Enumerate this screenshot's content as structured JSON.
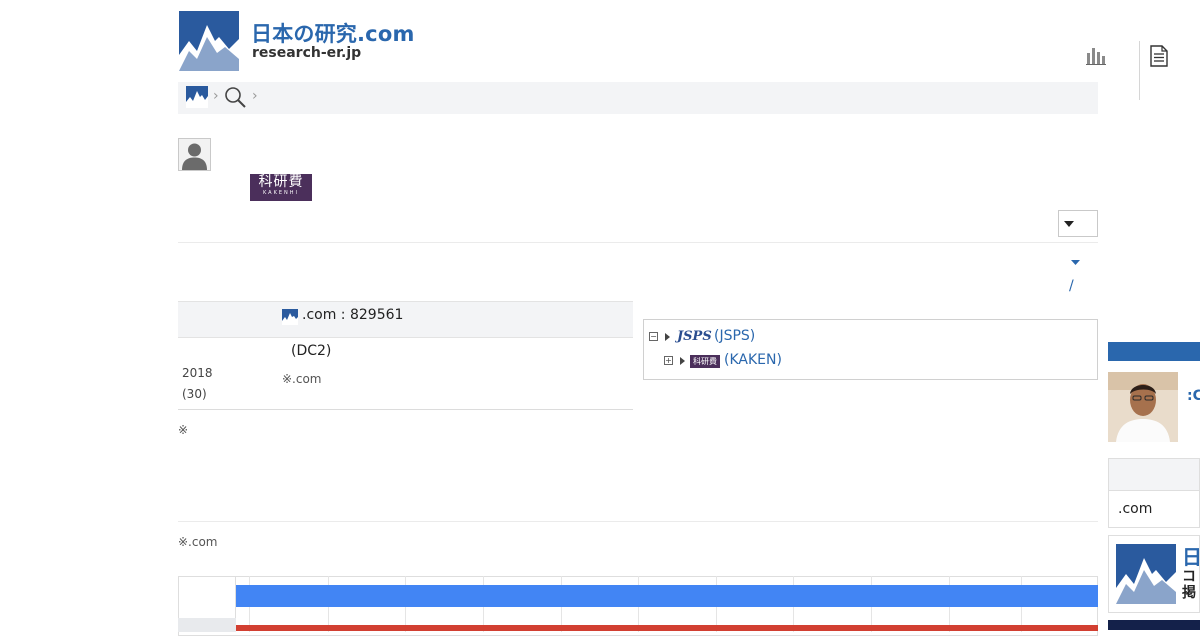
{
  "header": {
    "site_title": "日本の研究.com",
    "site_domain": "research-er.jp",
    "ranking_icon": "bar-chart-icon",
    "document_icon": "document-icon"
  },
  "breadcrumb": {
    "home_icon": "mountain-logo-icon",
    "search_icon": "search-icon",
    "separator": "›"
  },
  "kakenhi_logo": {
    "kanji": "科研費",
    "romaji": "KAKENHI"
  },
  "sort": {
    "slash": "/"
  },
  "info": {
    "id_text": ".com : 829561",
    "grant_type": "(DC2)",
    "year": "2018",
    "count": "(30)",
    "source_note": "※.com"
  },
  "note_mark": "※",
  "bottom_note": "※.com",
  "tree": {
    "jsps_mark": "JSPS",
    "jsps_label": "(JSPS)",
    "jsps_toggle": "−",
    "kaken_mark": "科研費",
    "kaken_label": "(KAKEN)",
    "kaken_toggle": "+"
  },
  "timeline": {
    "bar_colors": [
      "#4285f4",
      "#d23f31"
    ]
  },
  "sidebar": {
    "photo_label": ":C",
    "panel_item": ".com",
    "ad_title": "日",
    "ad_line1": "コ",
    "ad_line2": "掲"
  },
  "colors": {
    "brand_blue": "#2a67ad",
    "kakenhi_purple": "#4b2f5b"
  }
}
